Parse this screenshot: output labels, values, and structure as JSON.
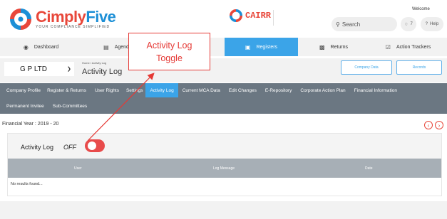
{
  "header": {
    "brand": {
      "name_a": "Cimply",
      "name_b": "Five",
      "tagline": "YOUR COMPLIANCE SIMPLIFIED"
    },
    "cairr": "CAIRR",
    "search_label": "Search",
    "notification_count": "7",
    "help_label": "Help",
    "welcome": "Welcome"
  },
  "main_nav": [
    {
      "label": "Dashboard",
      "icon": "dashboard-icon"
    },
    {
      "label": "Agenda",
      "icon": "list-icon"
    },
    {
      "label": "Registers",
      "icon": "folder-icon",
      "active": true
    },
    {
      "label": "Returns",
      "icon": "document-icon"
    },
    {
      "label": "Action Trackers",
      "icon": "tracker-icon"
    }
  ],
  "company": {
    "selected": "G P LTD",
    "breadcrumb": "Home  /  Activity Log",
    "page_title": "Activity Log",
    "company_data_btn": "Company Data",
    "records_btn": "Records"
  },
  "sub_nav": {
    "row1": [
      "Company Profile",
      "Register & Returns",
      "User Rights",
      "Settings",
      "Activity Log",
      "Current MCA Data",
      "Edit Changes",
      "E-Repository",
      "Corporate Action Plan",
      "Financial Information"
    ],
    "row2": [
      "Permanent Invitee",
      "Sub-Committees"
    ],
    "active": "Activity Log"
  },
  "financial_year": "Financial Year : 2019 - 20",
  "activity_log": {
    "label": "Activity Log",
    "state": "OFF",
    "columns": [
      "User",
      "Log Message",
      "Date"
    ],
    "empty_text": "No results found..."
  },
  "annotation": {
    "line1": "Activity Log",
    "line2": "Toggle"
  },
  "colors": {
    "brand_red": "#e8473a",
    "brand_blue": "#1c8fd6",
    "accent": "#3ba4e8",
    "subnav_bg": "#6b7782",
    "toggle_off": "#e84b4b"
  }
}
